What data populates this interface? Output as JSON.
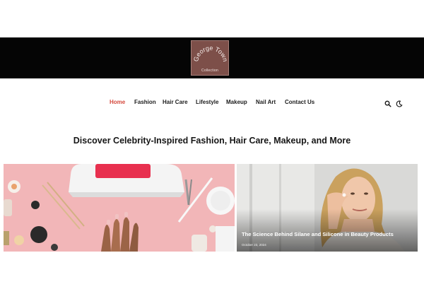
{
  "header": {
    "logo_title": "George Town",
    "logo_subtitle": "Collection"
  },
  "nav": {
    "items": [
      {
        "label": "Home",
        "active": true
      },
      {
        "label": "Fashion",
        "active": false
      },
      {
        "label": "Hair Care",
        "active": false
      },
      {
        "label": "Lifestyle",
        "active": false
      },
      {
        "label": "Makeup",
        "active": false
      },
      {
        "label": "Nail Art",
        "active": false
      },
      {
        "label": "Contact Us",
        "active": false
      }
    ],
    "icons": [
      "search-icon",
      "dark-mode-icon"
    ],
    "active_color": "#d54a3e"
  },
  "main": {
    "headline": "Discover Celebrity-Inspired Fashion, Hair Care, Makeup, and More",
    "cards": [
      {
        "title": "",
        "date": "",
        "image": "nail-lamp-manicure-photo"
      },
      {
        "title": "The Science Behind Silane and Silicone in Beauty Products",
        "date": "October 23, 2024",
        "image": "woman-applying-skincare-photo"
      }
    ]
  }
}
